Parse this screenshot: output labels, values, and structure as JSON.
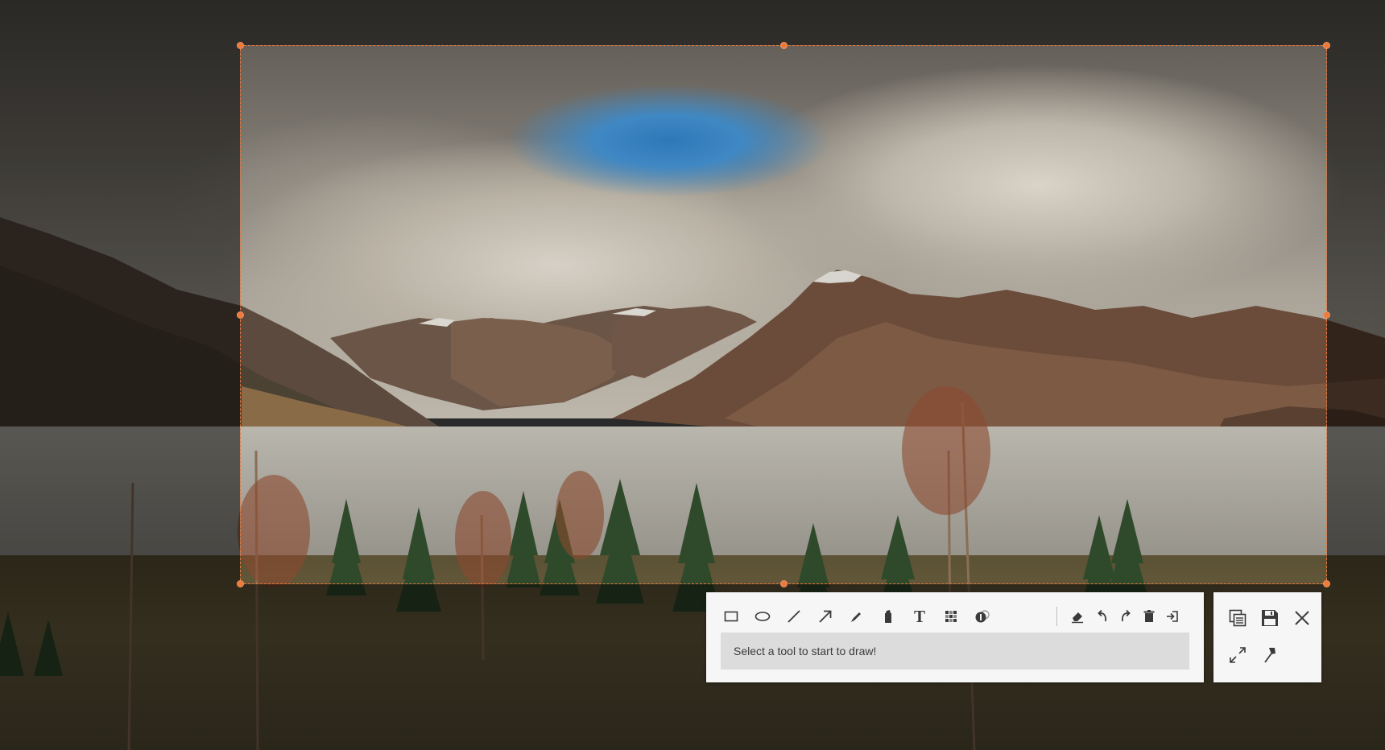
{
  "toolbar": {
    "hint": "Select a tool to start to draw!",
    "tools": [
      {
        "name": "rectangle-icon"
      },
      {
        "name": "ellipse-icon"
      },
      {
        "name": "line-icon"
      },
      {
        "name": "arrow-icon"
      },
      {
        "name": "pencil-icon"
      },
      {
        "name": "marker-icon"
      },
      {
        "name": "text-icon",
        "glyph": "T"
      },
      {
        "name": "mosaic-icon"
      },
      {
        "name": "step-number-icon"
      }
    ],
    "actions": [
      {
        "name": "eraser-icon"
      },
      {
        "name": "undo-icon"
      },
      {
        "name": "redo-icon"
      },
      {
        "name": "delete-icon"
      },
      {
        "name": "exit-icon"
      }
    ]
  },
  "side_panel": {
    "buttons": [
      {
        "name": "copy-icon"
      },
      {
        "name": "save-icon"
      },
      {
        "name": "close-icon"
      },
      {
        "name": "fullscreen-icon"
      },
      {
        "name": "pin-icon"
      }
    ]
  },
  "colors": {
    "accent": "#e8763a",
    "toolbar_bg": "#f6f6f6",
    "hint_bg": "#dcdcdc",
    "icon": "#3a3a3a"
  }
}
